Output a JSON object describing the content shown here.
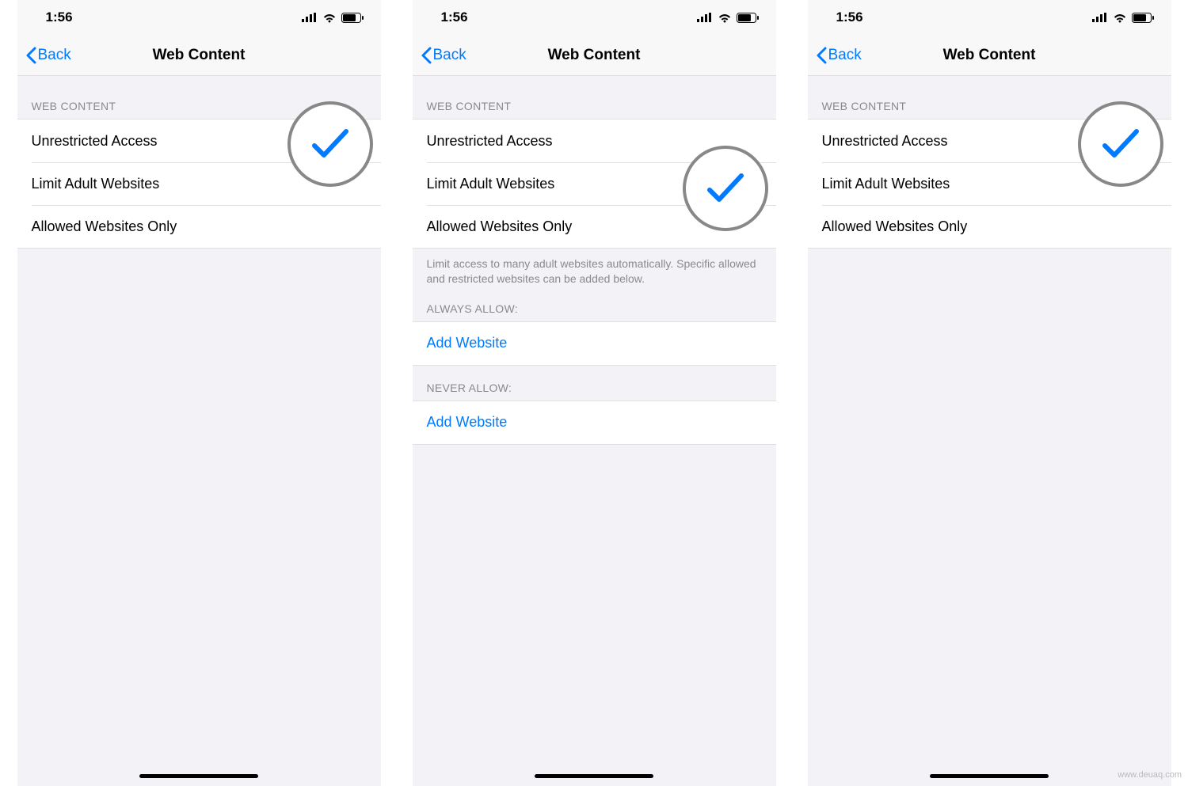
{
  "watermark": "www.deuaq.com",
  "statusTime": "1:56",
  "screens": [
    {
      "backLabel": "Back",
      "title": "Web Content",
      "sectionHeader": "WEB CONTENT",
      "options": [
        {
          "label": "Unrestricted Access",
          "checked": true
        },
        {
          "label": "Limit Adult Websites",
          "checked": false
        },
        {
          "label": "Allowed Websites Only",
          "checked": false
        }
      ],
      "highlightIndex": 0,
      "extras": null
    },
    {
      "backLabel": "Back",
      "title": "Web Content",
      "sectionHeader": "WEB CONTENT",
      "options": [
        {
          "label": "Unrestricted Access",
          "checked": false
        },
        {
          "label": "Limit Adult Websites",
          "checked": true
        },
        {
          "label": "Allowed Websites Only",
          "checked": false
        }
      ],
      "highlightIndex": 1,
      "extras": {
        "footer": "Limit access to many adult websites automatically. Specific allowed and restricted websites can be added below.",
        "alwaysAllowHeader": "ALWAYS ALLOW:",
        "alwaysAllowAction": "Add Website",
        "neverAllowHeader": "NEVER ALLOW:",
        "neverAllowAction": "Add Website"
      }
    },
    {
      "backLabel": "Back",
      "title": "Web Content",
      "sectionHeader": "WEB CONTENT",
      "options": [
        {
          "label": "Unrestricted Access",
          "checked": true
        },
        {
          "label": "Limit Adult Websites",
          "checked": false
        },
        {
          "label": "Allowed Websites Only",
          "checked": false
        }
      ],
      "highlightIndex": 0,
      "extras": null
    }
  ]
}
